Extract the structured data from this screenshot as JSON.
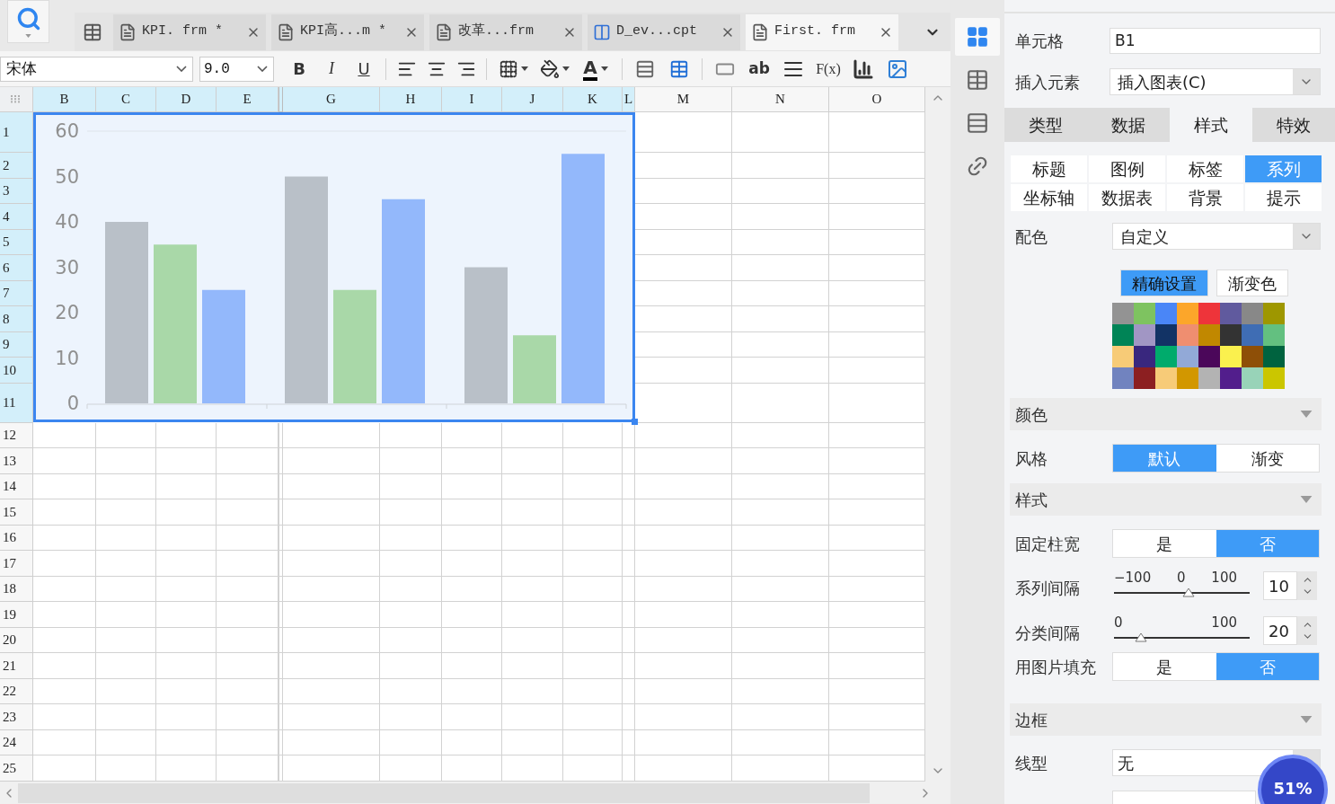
{
  "tabs": [
    {
      "label": "KPI. frm *",
      "selected": false,
      "kind": "form"
    },
    {
      "label": "KPI高...m *",
      "selected": false,
      "kind": "form"
    },
    {
      "label": "改革...frm",
      "selected": false,
      "kind": "form"
    },
    {
      "label": "D_ev...cpt",
      "selected": false,
      "kind": "report"
    },
    {
      "label": "First. frm",
      "selected": true,
      "kind": "form"
    }
  ],
  "toolbar": {
    "font": "宋体",
    "size": "9.0",
    "tools": [
      {
        "kind": "bold",
        "text": "B"
      },
      {
        "kind": "italic",
        "text": "I"
      },
      {
        "kind": "underline",
        "text": "U"
      },
      {
        "kind": "separator"
      },
      {
        "kind": "align_left"
      },
      {
        "kind": "align_center"
      },
      {
        "kind": "align_right"
      },
      {
        "kind": "separator"
      },
      {
        "kind": "border"
      },
      {
        "kind": "fill"
      },
      {
        "kind": "font_color",
        "text": "A"
      },
      {
        "kind": "separator"
      },
      {
        "kind": "merge"
      },
      {
        "kind": "table"
      },
      {
        "kind": "separator"
      },
      {
        "kind": "field"
      },
      {
        "kind": "text",
        "text": "ab"
      },
      {
        "kind": "wrap"
      },
      {
        "kind": "formula",
        "text": "F(x)"
      },
      {
        "kind": "chart"
      },
      {
        "kind": "image"
      }
    ]
  },
  "columns": [
    {
      "label": "B",
      "selected": true
    },
    {
      "label": "C",
      "selected": true
    },
    {
      "label": "D",
      "selected": true
    },
    {
      "label": "E",
      "selected": true
    },
    {
      "hidden": true,
      "selected": true
    },
    {
      "label": "G",
      "selected": true
    },
    {
      "label": "H",
      "selected": true
    },
    {
      "label": "I",
      "selected": true
    },
    {
      "label": "J",
      "selected": true
    },
    {
      "label": "K",
      "selected": true
    },
    {
      "label": "L",
      "selected": true
    },
    {
      "label": "M",
      "selected": false
    },
    {
      "label": "N",
      "selected": false
    },
    {
      "label": "O",
      "selected": false
    }
  ],
  "rows": [
    {
      "label": "1",
      "selected": true
    },
    {
      "label": "2",
      "selected": true
    },
    {
      "label": "3",
      "selected": true
    },
    {
      "label": "4",
      "selected": true
    },
    {
      "label": "5",
      "selected": true
    },
    {
      "label": "6",
      "selected": true
    },
    {
      "label": "7",
      "selected": true
    },
    {
      "label": "8",
      "selected": true
    },
    {
      "label": "9",
      "selected": true
    },
    {
      "label": "10",
      "selected": true
    },
    {
      "label": "11",
      "selected": true
    },
    {
      "label": "12",
      "selected": false
    },
    {
      "label": "13",
      "selected": false
    },
    {
      "label": "14",
      "selected": false
    },
    {
      "label": "15",
      "selected": false
    },
    {
      "label": "16",
      "selected": false
    },
    {
      "label": "17",
      "selected": false
    },
    {
      "label": "18",
      "selected": false
    },
    {
      "label": "19",
      "selected": false
    },
    {
      "label": "20",
      "selected": false
    },
    {
      "label": "21",
      "selected": false
    },
    {
      "label": "22",
      "selected": false
    },
    {
      "label": "23",
      "selected": false
    },
    {
      "label": "24",
      "selected": false
    },
    {
      "label": "25",
      "selected": false
    }
  ],
  "chart": {
    "chart_data": {
      "type": "bar",
      "ylim": [
        0,
        60
      ],
      "yticks": [
        0,
        10,
        20,
        30,
        40,
        50,
        60
      ],
      "series": [
        {
          "color": "#b9c0c8",
          "values": [
            40,
            50,
            30
          ]
        },
        {
          "color": "#a9d8a8",
          "values": [
            35,
            25,
            15
          ]
        },
        {
          "color": "#93b8fb",
          "values": [
            25,
            45,
            55
          ]
        }
      ]
    }
  },
  "side_icons": [
    {
      "kind": "layout",
      "selected": true
    },
    {
      "kind": "info",
      "selected": false
    },
    {
      "kind": "list",
      "selected": false
    },
    {
      "kind": "link",
      "selected": false
    }
  ],
  "panel": {
    "cell": {
      "label": "单元格",
      "value": "B1"
    },
    "insert": {
      "label": "插入元素",
      "value": "插入图表(C)"
    },
    "main_tabs": [
      {
        "label": "类型",
        "selected": false
      },
      {
        "label": "数据",
        "selected": false
      },
      {
        "label": "样式",
        "selected": true
      },
      {
        "label": "特效",
        "selected": false
      }
    ],
    "sub_tabs": [
      {
        "label": "标题",
        "selected": false
      },
      {
        "label": "图例",
        "selected": false
      },
      {
        "label": "标签",
        "selected": false
      },
      {
        "label": "系列",
        "selected": true
      },
      {
        "label": "坐标轴",
        "selected": false
      },
      {
        "label": "数据表",
        "selected": false
      },
      {
        "label": "背景",
        "selected": false
      },
      {
        "label": "提示",
        "selected": false
      }
    ],
    "scheme": {
      "label": "配色",
      "value": "自定义"
    },
    "scheme_modes": [
      {
        "label": "精确设置",
        "selected": true
      },
      {
        "label": "渐变色",
        "selected": false
      }
    ],
    "swatches": [
      {
        "color": "#939393"
      },
      {
        "color": "#7ec360"
      },
      {
        "color": "#4a86f7"
      },
      {
        "color": "#fca62a"
      },
      {
        "color": "#ee343a"
      },
      {
        "color": "#605a9e"
      },
      {
        "color": "#888888"
      },
      {
        "color": "#9e9700"
      },
      {
        "color": "#008456"
      },
      {
        "color": "#a196c4"
      },
      {
        "color": "#123365"
      },
      {
        "color": "#ef8e70"
      },
      {
        "color": "#c18800"
      },
      {
        "color": "#333333"
      },
      {
        "color": "#3f6db4"
      },
      {
        "color": "#63c080"
      },
      {
        "color": "#f7cb77"
      },
      {
        "color": "#39277e"
      },
      {
        "color": "#00ab6c"
      },
      {
        "color": "#92a9d7"
      },
      {
        "color": "#4b075a"
      },
      {
        "color": "#faf04e"
      },
      {
        "color": "#8e4f07"
      },
      {
        "color": "#00633f"
      },
      {
        "color": "#7183bf"
      },
      {
        "color": "#8c1f21"
      },
      {
        "color": "#f7cb78"
      },
      {
        "color": "#d29700"
      },
      {
        "color": "#b3b3b3"
      },
      {
        "color": "#521e8c"
      },
      {
        "color": "#98d3b8"
      },
      {
        "color": "#cbc600"
      }
    ],
    "items": [
      {
        "kind": "section",
        "title": "颜色"
      },
      {
        "kind": "segmented",
        "label": "风格",
        "options": [
          {
            "label": "默认",
            "selected": true
          },
          {
            "label": "渐变",
            "selected": false
          }
        ]
      },
      {
        "kind": "section",
        "title": "样式"
      },
      {
        "kind": "segmented",
        "label": "固定柱宽",
        "options": [
          {
            "label": "是",
            "selected": false
          },
          {
            "label": "否",
            "selected": true
          }
        ]
      },
      {
        "kind": "slider",
        "label": "系列间隔",
        "ticks": [
          "−100",
          "0",
          "100"
        ],
        "level": 0.55,
        "value": "10"
      },
      {
        "kind": "slider",
        "label": "分类间隔",
        "ticks": [
          "0",
          "100"
        ],
        "level": 0.2,
        "value": "20"
      },
      {
        "kind": "segmented",
        "label": "用图片填充",
        "options": [
          {
            "label": "是",
            "selected": false
          },
          {
            "label": "否",
            "selected": true
          }
        ]
      },
      {
        "kind": "section",
        "title": "边框"
      },
      {
        "kind": "select",
        "label": "线型",
        "value": "无"
      },
      {
        "kind": "field"
      }
    ]
  },
  "badge": {
    "label": "51%"
  }
}
